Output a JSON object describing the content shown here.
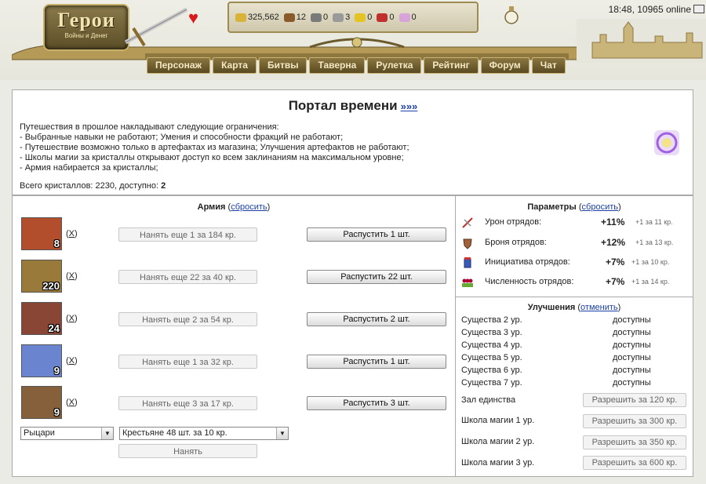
{
  "header": {
    "logo_line1": "Герои",
    "logo_line2": "Войны и Денег",
    "clock": "18:48, 10965 online",
    "resources": [
      {
        "name": "gold",
        "value": "325,562",
        "color": "#d9b23a"
      },
      {
        "name": "wood",
        "value": "12",
        "color": "#8a5a2b"
      },
      {
        "name": "ore",
        "value": "0",
        "color": "#7a7a7a"
      },
      {
        "name": "mercury",
        "value": "3",
        "color": "#9a9a9a"
      },
      {
        "name": "sulfur",
        "value": "0",
        "color": "#e3c424"
      },
      {
        "name": "crystals",
        "value": "0",
        "color": "#c0302c"
      },
      {
        "name": "gems",
        "value": "0",
        "color": "#d7a4d9"
      }
    ],
    "nav": [
      "Персонаж",
      "Карта",
      "Битвы",
      "Таверна",
      "Рулетка",
      "Рейтинг",
      "Форум",
      "Чат"
    ]
  },
  "portal": {
    "title": "Портал времени",
    "title_link": "»»»",
    "description": [
      "Путешествия в прошлое накладывают следующие ограничения:",
      "- Выбранные навыки не работают; Умения и способности фракций не работают;",
      "- Путешествие возможно только в артефактах из магазина; Улучшения артефактов не работают;",
      "- Школы магии за кристаллы открывают доступ ко всем заклинаниям на максимальном уровне;",
      "- Армия набирается за кристаллы;"
    ],
    "crystals_text": "Всего кристаллов: 2230, доступно:",
    "crystals_available": "2"
  },
  "army": {
    "title": "Армия",
    "reset_link": "сбросить",
    "units": [
      {
        "count": "8",
        "remove": "X",
        "hire": "Нанять еще 1 за 184 кр.",
        "dismiss": "Распустить 1 шт.",
        "color": "#9b3a22"
      },
      {
        "count": "220",
        "remove": "X",
        "hire": "Нанять еще 22 за 40 кр.",
        "dismiss": "Распустить 22 шт.",
        "color": "#8a6a2a"
      },
      {
        "count": "24",
        "remove": "X",
        "hire": "Нанять еще 2 за 54 кр.",
        "dismiss": "Распустить 2 шт.",
        "color": "#7c3a2e"
      },
      {
        "count": "9",
        "remove": "X",
        "hire": "Нанять еще 1 за 32 кр.",
        "dismiss": "Распустить 1 шт.",
        "color": "#5b74c2"
      },
      {
        "count": "9",
        "remove": "X",
        "hire": "Нанять еще 3 за 17 кр.",
        "dismiss": "Распустить 3 шт.",
        "color": "#7a5432"
      }
    ],
    "faction_select": "Рыцари",
    "creature_select": "Крестьяне 48 шт. за 10 кр.",
    "hire_button": "Нанять"
  },
  "params": {
    "title": "Параметры",
    "reset_link": "сбросить",
    "rows": [
      {
        "label": "Урон отрядов:",
        "value": "+11%",
        "cost": "+1 за 11 кр."
      },
      {
        "label": "Броня отрядов:",
        "value": "+12%",
        "cost": "+1 за 13 кр."
      },
      {
        "label": "Инициатива отрядов:",
        "value": "+7%",
        "cost": "+1 за 10 кр."
      },
      {
        "label": "Численность отрядов:",
        "value": "+7%",
        "cost": "+1 за 14 кр."
      }
    ]
  },
  "upgrades": {
    "title": "Улучшения",
    "cancel_link": "отменить",
    "creatures": [
      {
        "label": "Существа 2 ур.",
        "status": "доступны"
      },
      {
        "label": "Существа 3 ур.",
        "status": "доступны"
      },
      {
        "label": "Существа 4 ур.",
        "status": "доступны"
      },
      {
        "label": "Существа 5 ур.",
        "status": "доступны"
      },
      {
        "label": "Существа 6 ур.",
        "status": "доступны"
      },
      {
        "label": "Существа 7 ур.",
        "status": "доступны"
      }
    ],
    "buildings": [
      {
        "label": "Зал единства",
        "button": "Разрешить за 120 кр."
      },
      {
        "label": "Школа магии 1 ур.",
        "button": "Разрешить за 300 кр."
      },
      {
        "label": "Школа магии 2 ур.",
        "button": "Разрешить за 350 кр."
      },
      {
        "label": "Школа магии 3 ур.",
        "button": "Разрешить за 600 кр."
      }
    ]
  }
}
